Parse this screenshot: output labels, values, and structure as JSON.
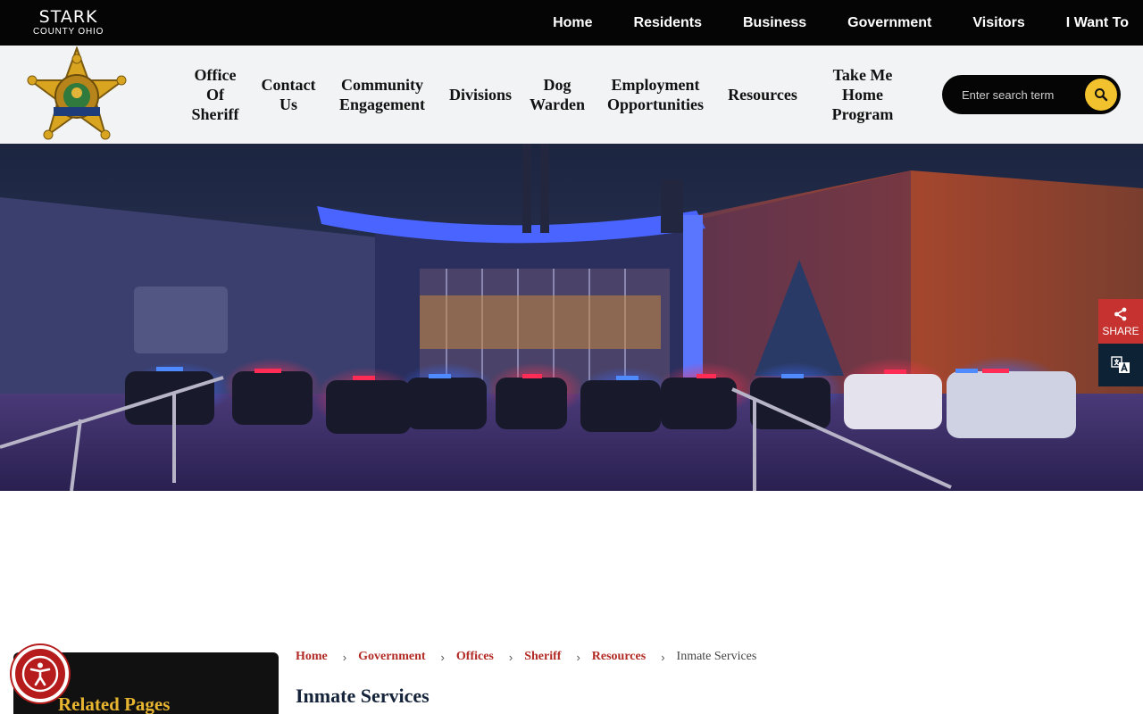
{
  "brand": {
    "line1": "STARK",
    "line2": "COUNTY OHIO"
  },
  "top_nav": [
    "Home",
    "Residents",
    "Business",
    "Government",
    "Visitors",
    "I Want To"
  ],
  "sub_nav": [
    {
      "lines": [
        "Office",
        "Of",
        "Sheriff"
      ]
    },
    {
      "lines": [
        "Contact",
        "Us"
      ]
    },
    {
      "lines": [
        "Community",
        "Engagement"
      ]
    },
    {
      "lines": [
        "Divisions"
      ]
    },
    {
      "lines": [
        "Dog",
        "Warden"
      ]
    },
    {
      "lines": [
        "Employment",
        "Opportunities"
      ]
    },
    {
      "lines": [
        "Resources"
      ]
    },
    {
      "lines": [
        "Take Me",
        "Home",
        "Program"
      ]
    }
  ],
  "search": {
    "placeholder": "Enter search term"
  },
  "share": {
    "label": "SHARE"
  },
  "related": {
    "title": "Related Pages"
  },
  "breadcrumb": {
    "links": [
      "Home",
      "Government",
      "Offices",
      "Sheriff",
      "Resources"
    ],
    "current": "Inmate Services"
  },
  "page": {
    "title": "Inmate Services"
  },
  "colors": {
    "accent": "#b22a24",
    "search_button": "#f2c12e",
    "share": "#c6322f",
    "topbar": "#050505"
  },
  "icons": {
    "search": "search-icon",
    "share": "share-icon",
    "translate": "translate-icon",
    "accessibility": "accessibility-icon",
    "badge": "sheriff-badge-icon"
  }
}
